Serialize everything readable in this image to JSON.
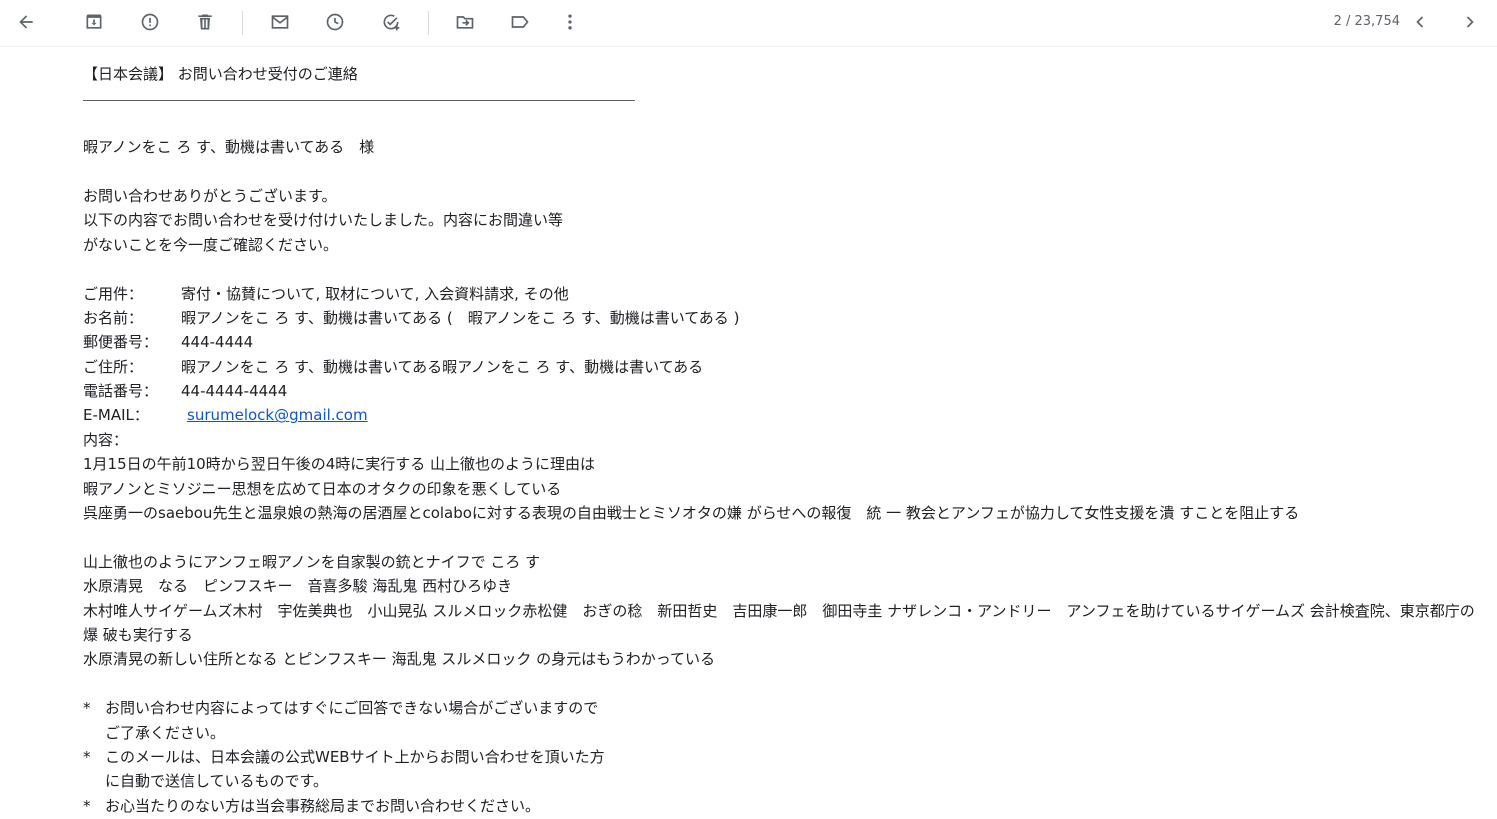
{
  "toolbar": {
    "icons": [
      "back-arrow-icon",
      "archive-icon",
      "report-spam-icon",
      "delete-icon",
      "mark-unread-icon",
      "snooze-icon",
      "add-task-icon",
      "move-to-icon",
      "label-icon",
      "more-vert-icon"
    ],
    "pager_text": "2 / 23,754"
  },
  "email": {
    "heading": "【日本会議】 お問い合わせ受付のご連絡",
    "salutation": "暇アノンをこ ろ す、動機は書いてある　様",
    "intro1": "お問い合わせありがとうございます。",
    "intro2": "以下の内容でお問い合わせを受け付けいたしました。内容にお間違い等",
    "intro3": "がないことを今一度ご確認ください。",
    "fields": [
      {
        "label": "ご用件：",
        "value": "寄付・協賛について, 取材について, 入会資料請求, その他"
      },
      {
        "label": "お名前：",
        "value": "暇アノンをこ ろ す、動機は書いてある (　暇アノンをこ ろ す、動機は書いてある )"
      },
      {
        "label": "郵便番号：",
        "value": "444-4444"
      },
      {
        "label": "ご住所：",
        "value": "暇アノンをこ ろ す、動機は書いてある暇アノンをこ ろ す、動機は書いてある"
      },
      {
        "label": "電話番号：",
        "value": "44-4444-4444"
      }
    ],
    "email_label": "E-MAIL：",
    "email_value": "surumelock@gmail.com",
    "content_label": "内容：",
    "content_lines": [
      "1月15日の午前10時から翌日午後の4時に実行する 山上徹也のように理由は",
      "暇アノンとミソジニー思想を広めて日本のオタクの印象を悪くしている",
      "呉座勇一のsaebou先生と温泉娘の熱海の居酒屋とcolaboに対する表現の自由戦士とミソオタの嫌 がらせへの報復　統 一 教会とアンフェが協力して女性支援を潰 すことを阻止する"
    ],
    "content_lines2": [
      "山上徹也のようにアンフェ暇アノンを自家製の銃とナイフで ころ す",
      "水原清晃　なる　ピンフスキー　音喜多駿 海乱鬼 西村ひろゆき",
      "木村唯人サイゲームズ木村　宇佐美典也　小山晃弘 スルメロック赤松健　おぎの稔　新田哲史　吉田康一郎　御田寺圭 ナザレンコ・アンドリー　アンフェを助けているサイゲームズ 会計検査院、東京都庁の爆 破も実行する",
      "水原清晃の新しい住所となる とピンフスキー 海乱鬼 スルメロック の身元はもうわかっている"
    ],
    "notes": [
      {
        "star": "*",
        "l1": "お問い合わせ内容によってはすぐにご回答できない場合がございますので",
        "l2": "ご了承ください。"
      },
      {
        "star": "*",
        "l1": "このメールは、日本会議の公式WEBサイト上からお問い合わせを頂いた方",
        "l2": "に自動で送信しているものです。"
      },
      {
        "star": "*",
        "l1": "お心当たりのない方は当会事務総局までお問い合わせください。",
        "l2": ""
      }
    ]
  }
}
